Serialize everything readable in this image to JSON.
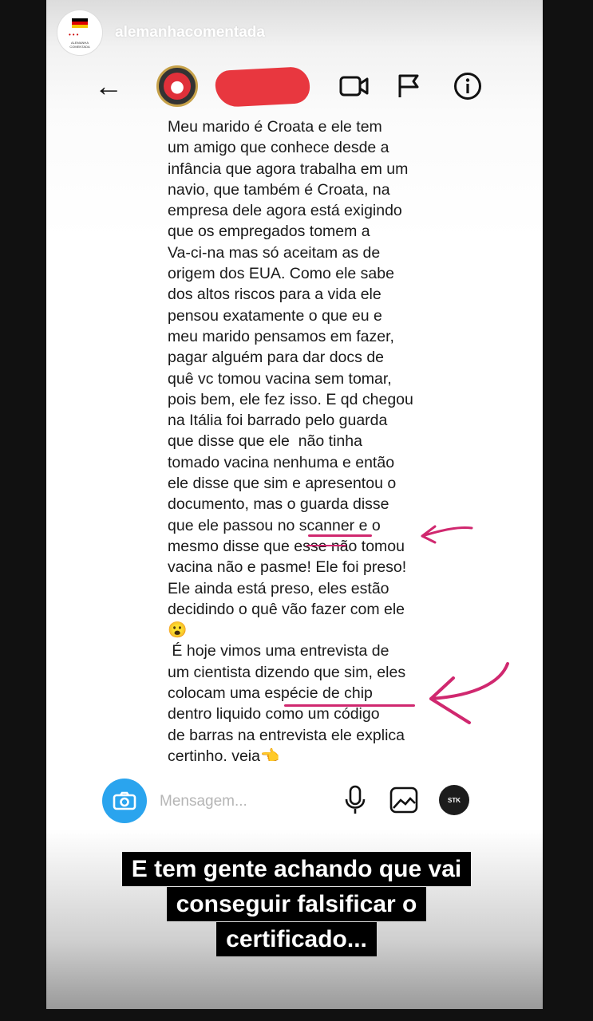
{
  "story": {
    "username": "alemanhacomentada",
    "avatar_brand_text": "ALEMANHA COMENTADA",
    "avatar_icon": "germany-flag-logo"
  },
  "dm_header": {
    "back_icon": "back-arrow-icon",
    "contact_name_redacted": true,
    "video_icon": "video-call-icon",
    "flag_icon": "report-flag-icon",
    "info_icon": "info-icon"
  },
  "message": {
    "lines": [
      "Meu marido é Croata e ele tem",
      "um amigo que conhece desde a",
      "infância que agora trabalha em um",
      "navio, que também é Croata, na",
      "empresa dele agora está exigindo",
      "que os empregados tomem a",
      "Va-ci-na mas só aceitam as de",
      "origem dos EUA. Como ele sabe",
      "dos altos riscos para a vida ele",
      "pensou exatamente o que eu e",
      "meu marido pensamos em fazer,",
      "pagar alguém para dar docs de",
      "quê vc tomou vacina sem tomar,",
      "pois bem, ele fez isso. E qd chegou",
      "na Itália foi barrado pelo guarda",
      "que disse que ele  não tinha",
      "tomado vacina nenhuma e então",
      "ele disse que sim e apresentou o",
      "documento, mas o guarda disse",
      "que ele passou no scanner e o",
      "mesmo disse que esse não tomou",
      "vacina não e pasme! Ele foi preso!",
      "Ele ainda está preso, eles estão",
      "decidindo o quê vão fazer com ele",
      "😮",
      " É hoje vimos uma entrevista de",
      "um cientista dizendo que sim, eles",
      "colocam uma espécie de chip",
      "dentro liquido como um código",
      "de barras na entrevista ele explica",
      "certinho, veja👈"
    ]
  },
  "composer": {
    "placeholder": "Mensagem...",
    "camera_icon": "camera-icon",
    "mic_icon": "microphone-icon",
    "gallery_icon": "gallery-icon",
    "sticker_icon": "sticker-icon"
  },
  "caption": {
    "lines": [
      "E tem gente achando que vai",
      "conseguir falsificar o",
      "certificado..."
    ]
  },
  "colors": {
    "annotation": "#d0286f",
    "camera_button": "#2aa4ee",
    "redaction": "#e8373f"
  }
}
